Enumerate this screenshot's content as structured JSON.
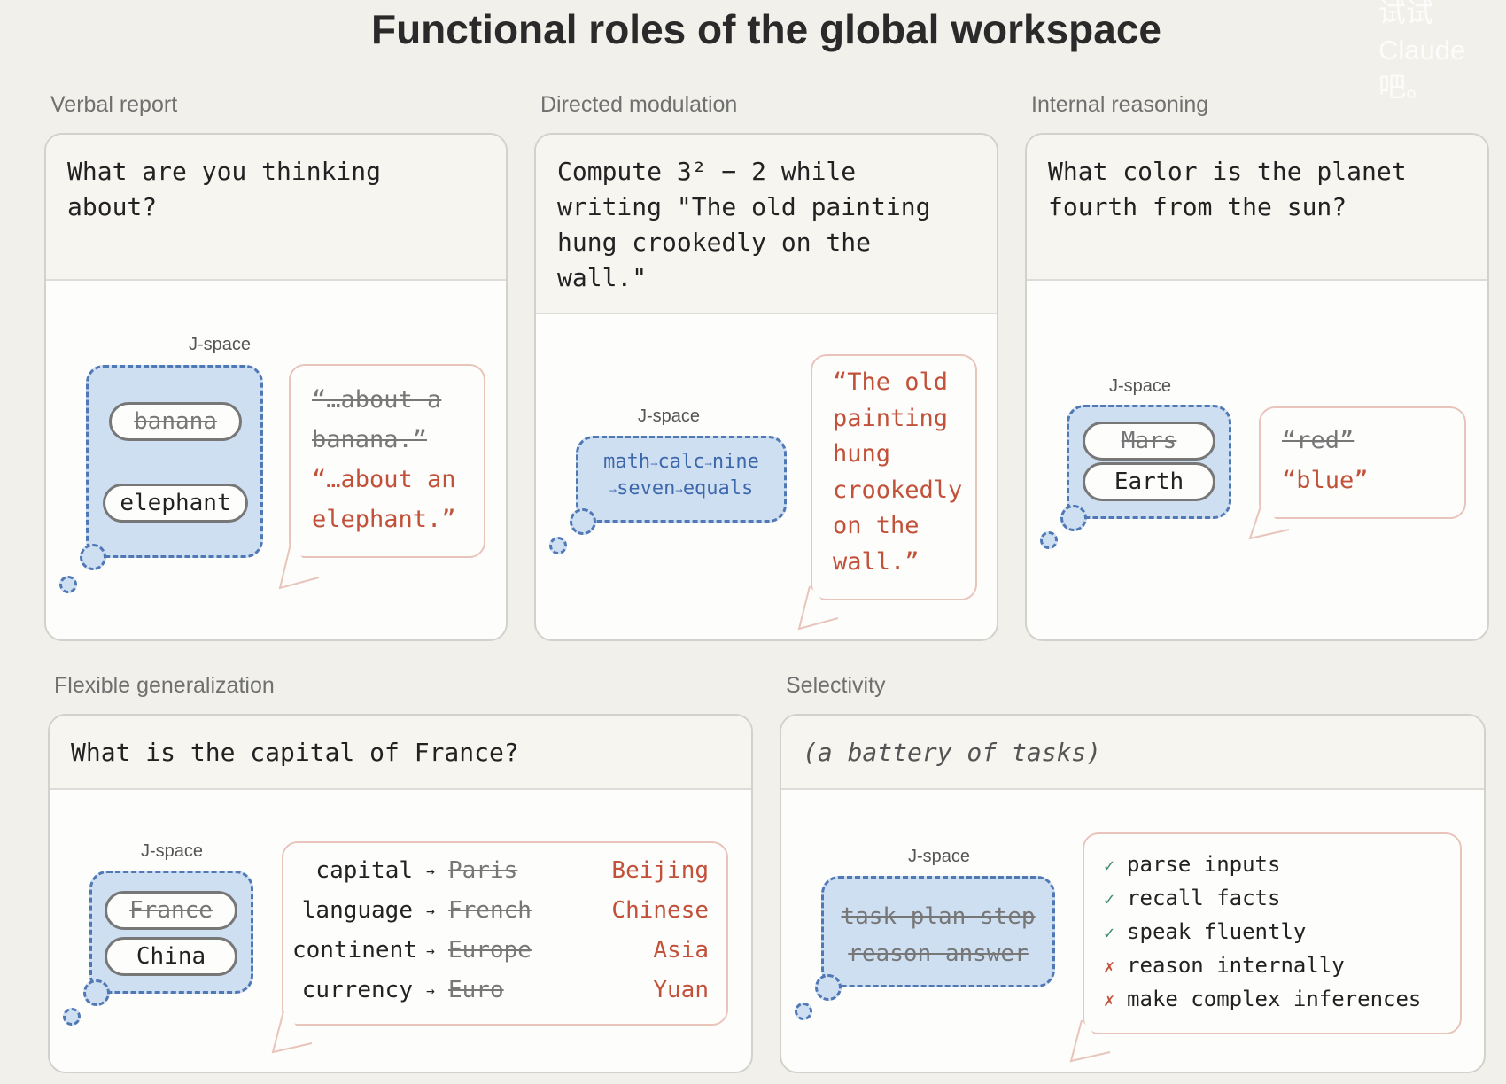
{
  "title": "Functional roles of the global workspace",
  "watermark": [
    "试试",
    "Claude",
    "吧。"
  ],
  "jspace_label": "J-space",
  "sections": {
    "verbal": {
      "label": "Verbal report",
      "prompt": "What are you thinking\nabout?",
      "jspace_items": [
        {
          "text": "banana",
          "struck": true
        },
        {
          "text": "elephant",
          "struck": false
        }
      ],
      "speech_lines": [
        {
          "text": "“…about a",
          "struck": true
        },
        {
          "text": "banana.”",
          "struck": true
        },
        {
          "text": "“…about an",
          "struck": false
        },
        {
          "text": "elephant.”",
          "struck": false
        }
      ]
    },
    "directed": {
      "label": "Directed modulation",
      "prompt": "Compute 3² − 2 while\nwriting \"The old painting\nhung crookedly on the\nwall.\"",
      "chain_line1": [
        "math",
        "calc",
        "nine"
      ],
      "chain_line2": [
        "seven",
        "equals"
      ],
      "arrow": "→",
      "speech_lines": [
        "“The old",
        "painting",
        "hung",
        "crookedly",
        "on the",
        "wall.”"
      ]
    },
    "internal": {
      "label": "Internal reasoning",
      "prompt": "What color is the planet\nfourth from the sun?",
      "jspace_items": [
        {
          "text": "Mars",
          "struck": true
        },
        {
          "text": "Earth",
          "struck": false
        }
      ],
      "speech_lines": [
        {
          "text": "“red”",
          "struck": true
        },
        {
          "text": "“blue”",
          "struck": false
        }
      ]
    },
    "flexible": {
      "label": "Flexible generalization",
      "prompt": "What is the capital of France?",
      "jspace_items": [
        {
          "text": "France",
          "struck": true
        },
        {
          "text": "China",
          "struck": false
        }
      ],
      "arrow": "→",
      "rows": [
        {
          "attr": "capital",
          "old": "Paris",
          "new": "Beijing"
        },
        {
          "attr": "language",
          "old": "French",
          "new": "Chinese"
        },
        {
          "attr": "continent",
          "old": "Europe",
          "new": "Asia"
        },
        {
          "attr": "currency",
          "old": "Euro",
          "new": "Yuan"
        }
      ]
    },
    "selectivity": {
      "label": "Selectivity",
      "prompt": "(a battery of tasks)",
      "jspace_line1": "task plan step",
      "jspace_line2": "reason answer",
      "items": [
        {
          "mark": "✓",
          "ok": true,
          "text": "parse inputs"
        },
        {
          "mark": "✓",
          "ok": true,
          "text": "recall facts"
        },
        {
          "mark": "✓",
          "ok": true,
          "text": "speak fluently"
        },
        {
          "mark": "✗",
          "ok": false,
          "text": "reason internally"
        },
        {
          "mark": "✗",
          "ok": false,
          "text": "make complex inferences"
        }
      ]
    }
  }
}
